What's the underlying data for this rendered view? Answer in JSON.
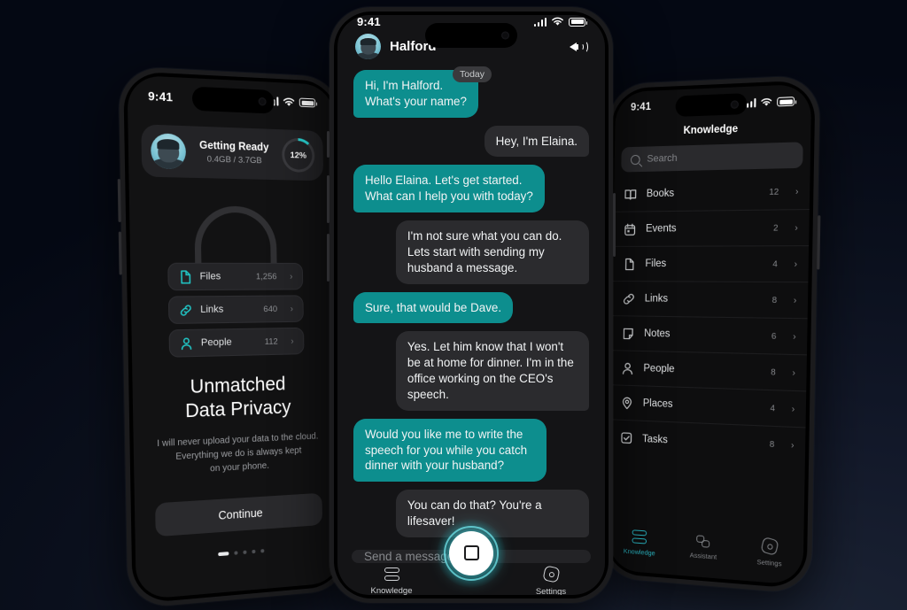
{
  "app": {
    "accent": "#0d8e8e",
    "accent_bright": "#2ad4d4",
    "bubble_me": "#2b2b2e",
    "background": "#040813"
  },
  "left_phone": {
    "status": {
      "time": "9:41",
      "icons": [
        "signal-icon",
        "wifi-icon",
        "battery-icon"
      ]
    },
    "card": {
      "title": "Getting Ready",
      "subtitle": "0.4GB / 3.7GB",
      "progress_label": "12%",
      "progress_value": 12,
      "avatar": "user-avatar"
    },
    "lock_icon": "padlock-icon",
    "pills": [
      {
        "icon": "file-icon",
        "label": "Files",
        "count": "1,256",
        "chevron": "›"
      },
      {
        "icon": "link-icon",
        "label": "Links",
        "count": "640",
        "chevron": "›"
      },
      {
        "icon": "person-icon",
        "label": "People",
        "count": "112",
        "chevron": "›"
      }
    ],
    "headline_line1": "Unmatched",
    "headline_line2": "Data Privacy",
    "body": "I will never upload your data to the cloud.\nEverything we do is always kept\non your phone.",
    "continue_label": "Continue",
    "pager": {
      "total": 5,
      "active": 0
    }
  },
  "center_phone": {
    "status": {
      "time": "9:41",
      "icons": [
        "signal-icon",
        "wifi-icon",
        "battery-icon"
      ]
    },
    "header": {
      "name": "Halford",
      "avatar": "user-avatar",
      "speaker_icon": "speaker-icon"
    },
    "day_chip": "Today",
    "messages": [
      {
        "from": "bot",
        "text": "Hi, I'm Halford.\nWhat's your name?"
      },
      {
        "from": "me",
        "text": "Hey, I'm Elaina."
      },
      {
        "from": "bot",
        "text": "Hello Elaina. Let's get started.\nWhat can I help you with today?"
      },
      {
        "from": "me",
        "text": "I'm not sure what you can do. Lets start with sending my husband a message."
      },
      {
        "from": "bot",
        "text": "Sure, that would be Dave."
      },
      {
        "from": "me",
        "text": "Yes. Let him know that I won't be at home for dinner. I'm in the office working on the CEO's speech."
      },
      {
        "from": "bot",
        "text": "Would you like me to write the speech for you while you catch dinner with your husband?"
      },
      {
        "from": "me",
        "text": "You can do that? You're a lifesaver!"
      }
    ],
    "composer_placeholder": "Send a message",
    "mic_button": "stop-record-button",
    "tabs": [
      {
        "icon": "knowledge-icon",
        "label": "Knowledge"
      },
      {
        "icon": "gear-icon",
        "label": "Settings"
      }
    ]
  },
  "right_phone": {
    "status": {
      "time": "9:41",
      "icons": [
        "signal-icon",
        "wifi-icon",
        "battery-icon"
      ]
    },
    "title": "Knowledge",
    "search_placeholder": "Search",
    "items": [
      {
        "icon": "book-icon",
        "label": "Books",
        "count": "12",
        "chevron": "›"
      },
      {
        "icon": "calendar-icon",
        "label": "Events",
        "count": "2",
        "chevron": "›"
      },
      {
        "icon": "file-icon",
        "label": "Files",
        "count": "4",
        "chevron": "›"
      },
      {
        "icon": "link-icon",
        "label": "Links",
        "count": "8",
        "chevron": "›"
      },
      {
        "icon": "note-icon",
        "label": "Notes",
        "count": "6",
        "chevron": "›"
      },
      {
        "icon": "person-icon",
        "label": "People",
        "count": "8",
        "chevron": "›"
      },
      {
        "icon": "pin-icon",
        "label": "Places",
        "count": "4",
        "chevron": "›"
      },
      {
        "icon": "task-icon",
        "label": "Tasks",
        "count": "8",
        "chevron": "›"
      }
    ],
    "nav": [
      {
        "icon": "knowledge-icon",
        "label": "Knowledge",
        "active": true
      },
      {
        "icon": "chat-icon",
        "label": "Assistant",
        "active": false
      },
      {
        "icon": "gear-icon",
        "label": "Settings",
        "active": false
      }
    ]
  }
}
